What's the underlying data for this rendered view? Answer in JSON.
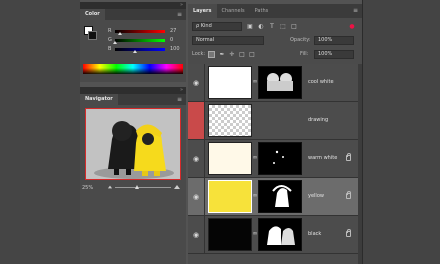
{
  "color_panel": {
    "tabs": [
      "Color"
    ],
    "sliders": [
      {
        "label": "R",
        "value": "27",
        "pos": 0.1,
        "gradient": "linear-gradient(to right,#000,#f00)"
      },
      {
        "label": "G",
        "value": "0",
        "pos": 0.0,
        "gradient": "linear-gradient(to right,#000,#0f0)"
      },
      {
        "label": "B",
        "value": "100",
        "pos": 0.4,
        "gradient": "linear-gradient(to right,#000,#00f)"
      }
    ],
    "foreground_color": "#ffffff",
    "background_color": "#111111"
  },
  "navigator_panel": {
    "tabs": [
      "Navigator"
    ],
    "zoom": "25%"
  },
  "layers_panel": {
    "tabs": [
      "Layers",
      "Channels",
      "Paths"
    ],
    "filter_kind": "ρ Kind",
    "blend_mode": "Normal",
    "opacity_label": "Opacity:",
    "opacity_value": "100%",
    "locks_label": "Lock:",
    "fill_label": "Fill:",
    "fill_value": "100%",
    "layers": [
      {
        "name": "cool white",
        "thumb": "white",
        "mask": "characters",
        "visible": true,
        "selected": false,
        "locked": false,
        "linked": true
      },
      {
        "name": "drawing",
        "thumb": "checker",
        "mask": "",
        "visible": false,
        "selected": false,
        "locked": false,
        "linked": false
      },
      {
        "name": "warm white",
        "thumb": "cream",
        "mask": "sparse",
        "visible": true,
        "selected": false,
        "locked": true,
        "linked": true
      },
      {
        "name": "yellow",
        "thumb": "yellow",
        "mask": "yellow-figure",
        "visible": true,
        "selected": true,
        "locked": true,
        "linked": true
      },
      {
        "name": "black",
        "thumb": "black",
        "mask": "black-figure",
        "visible": true,
        "selected": false,
        "locked": true,
        "linked": true
      }
    ]
  },
  "colors": {
    "selection_red": "#c94a4a",
    "layer_selected": "#6c6c6c",
    "yellow_fill": "#f7e23a",
    "cream_fill": "#fff9e8"
  }
}
